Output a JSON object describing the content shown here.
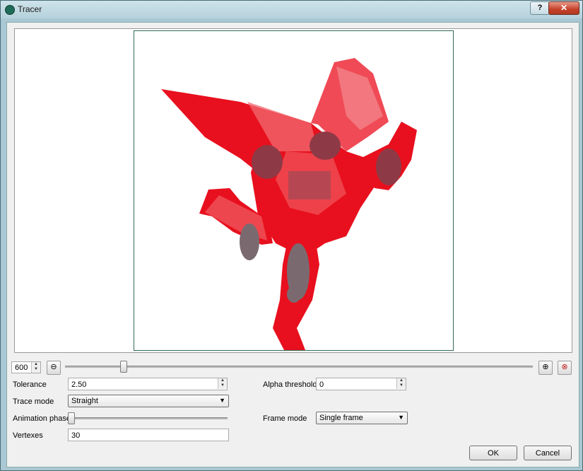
{
  "window": {
    "title": "Tracer"
  },
  "icons": {
    "app": "tracer-app-icon",
    "help": "?",
    "close": "✕"
  },
  "zoom": {
    "value": "600"
  },
  "fields": {
    "tolerance_label": "Tolerance",
    "tolerance_value": "2.50",
    "alpha_label": "Alpha threshold",
    "alpha_value": "0",
    "trace_mode_label": "Trace mode",
    "trace_mode_value": "Straight",
    "animation_phase_label": "Animation phase",
    "frame_mode_label": "Frame mode",
    "frame_mode_value": "Single frame",
    "vertexes_label": "Vertexes",
    "vertexes_value": "30"
  },
  "buttons": {
    "ok": "OK",
    "cancel": "Cancel"
  },
  "colors": {
    "trace_fill": "#e8101e",
    "trace_overlay": "#f26a70",
    "shadow": "#8e3a46",
    "frame_border": "#2e6b56"
  }
}
